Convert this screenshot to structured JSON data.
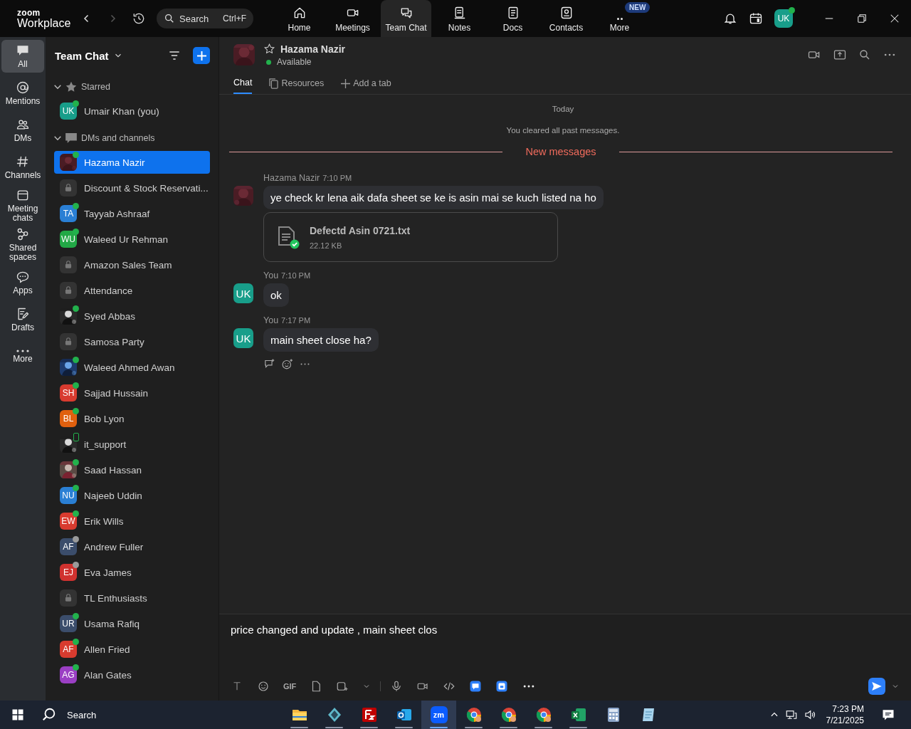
{
  "app": {
    "logo_top": "zoom",
    "logo_bottom": "Workplace"
  },
  "search": {
    "placeholder": "Search",
    "shortcut": "Ctrl+F"
  },
  "nav": [
    {
      "label": "Home",
      "selected": false
    },
    {
      "label": "Meetings",
      "selected": false
    },
    {
      "label": "Team Chat",
      "selected": true
    },
    {
      "label": "Notes",
      "selected": false
    },
    {
      "label": "Docs",
      "selected": false
    },
    {
      "label": "Contacts",
      "selected": false
    },
    {
      "label": "More",
      "selected": false,
      "badge": "NEW"
    }
  ],
  "user": {
    "initials": "UK",
    "online": true
  },
  "rail": [
    {
      "label": "All",
      "selected": true
    },
    {
      "label": "Mentions",
      "selected": false
    },
    {
      "label": "DMs",
      "selected": false
    },
    {
      "label": "Channels",
      "selected": false
    },
    {
      "label": "Meeting chats",
      "selected": false
    },
    {
      "label": "Shared spaces",
      "selected": false
    },
    {
      "label": "Apps",
      "selected": false
    },
    {
      "label": "Drafts",
      "selected": false
    },
    {
      "label": "More",
      "selected": false
    }
  ],
  "list": {
    "title": "Team Chat",
    "sections": [
      {
        "label": "Starred",
        "expanded": true,
        "items": [
          {
            "name": "Umair Khan (you)",
            "kind": "initials",
            "initials": "UK",
            "color": "#189e8a",
            "online": true,
            "selected": false
          }
        ]
      },
      {
        "label": "DMs and channels",
        "expanded": true,
        "items": [
          {
            "name": "Hazama Nazir",
            "kind": "picture",
            "online": true,
            "selected": true
          },
          {
            "name": "Discount & Stock Reservati...",
            "kind": "channel",
            "online": false,
            "selected": false
          },
          {
            "name": "Tayyab Ashraaf",
            "kind": "initials",
            "initials": "TA",
            "color": "#2a7fd4",
            "online": true,
            "selected": false
          },
          {
            "name": "Waleed Ur Rehman",
            "kind": "initials",
            "initials": "WU",
            "color": "#22a846",
            "online": true,
            "selected": false
          },
          {
            "name": "Amazon Sales Team",
            "kind": "channel",
            "online": false,
            "selected": false
          },
          {
            "name": "Attendance",
            "kind": "channel",
            "online": false,
            "selected": false
          },
          {
            "name": "Syed Abbas",
            "kind": "picture",
            "online": true,
            "selected": false
          },
          {
            "name": "Samosa Party",
            "kind": "channel",
            "online": false,
            "selected": false
          },
          {
            "name": "Waleed Ahmed Awan",
            "kind": "picture",
            "online": true,
            "selected": false
          },
          {
            "name": "Sajjad Hussain",
            "kind": "initials",
            "initials": "SH",
            "color": "#d83b2f",
            "online": true,
            "selected": false
          },
          {
            "name": "Bob Lyon",
            "kind": "initials",
            "initials": "BL",
            "color": "#e0600e",
            "online": true,
            "selected": false
          },
          {
            "name": "it_support",
            "kind": "picture",
            "online": false,
            "mobile": true,
            "selected": false
          },
          {
            "name": "Saad Hassan",
            "kind": "picture",
            "online": true,
            "selected": false
          },
          {
            "name": "Najeeb Uddin",
            "kind": "initials",
            "initials": "NU",
            "color": "#2a7fd4",
            "online": true,
            "selected": false
          },
          {
            "name": "Erik Wills",
            "kind": "initials",
            "initials": "EW",
            "color": "#d83b2f",
            "online": true,
            "selected": false
          },
          {
            "name": "Andrew Fuller",
            "kind": "initials",
            "initials": "AF",
            "color": "#3b4d6b",
            "online": false,
            "away": true,
            "selected": false
          },
          {
            "name": "Eva James",
            "kind": "initials",
            "initials": "EJ",
            "color": "#d0322f",
            "online": false,
            "away": true,
            "selected": false
          },
          {
            "name": "TL Enthusiasts",
            "kind": "channel",
            "online": false,
            "selected": false
          },
          {
            "name": "Usama Rafiq",
            "kind": "initials",
            "initials": "UR",
            "color": "#3b4d6b",
            "online": true,
            "selected": false
          },
          {
            "name": "Allen Fried",
            "kind": "initials",
            "initials": "AF",
            "color": "#d83b2f",
            "online": true,
            "selected": false
          },
          {
            "name": "Alan Gates",
            "kind": "initials",
            "initials": "AG",
            "color": "#9b3fc4",
            "online": true,
            "selected": false
          }
        ]
      }
    ]
  },
  "chat": {
    "name": "Hazama Nazir",
    "status": "Available",
    "starred": false,
    "tabs": [
      {
        "label": "Chat",
        "selected": true
      },
      {
        "label": "Resources",
        "selected": false
      },
      {
        "label": "Add a tab",
        "selected": false
      }
    ],
    "day": "Today",
    "notice": "You cleared all past messages.",
    "divider": "New messages",
    "messages": [
      {
        "sender": "Hazama Nazir",
        "time": "7:10 PM",
        "text": "ye check kr lena aik dafa sheet se ke is asin mai se kuch listed na ho",
        "attachment": {
          "name": "Defectd Asin 0721.txt",
          "size": "22.12 KB"
        },
        "hovered": false
      },
      {
        "sender": "You",
        "time": "7:10 PM",
        "avatar": {
          "kind": "initials",
          "initials": "UK",
          "color": "#189e8a"
        },
        "text": "ok",
        "hovered": false
      },
      {
        "sender": "You",
        "time": "7:17 PM",
        "avatar": {
          "kind": "initials",
          "initials": "UK",
          "color": "#189e8a"
        },
        "text": "main sheet close ha?",
        "hovered": true
      }
    ]
  },
  "composer": {
    "value": "price changed and update , main sheet clos",
    "gif": "GIF"
  },
  "taskbar": {
    "search": "Search",
    "time": "7:23 PM",
    "date": "7/21/2025",
    "apps": [
      {
        "kind": "folder",
        "running": true,
        "selected": false
      },
      {
        "kind": "gem",
        "running": true,
        "selected": false
      },
      {
        "kind": "filezilla",
        "running": true,
        "selected": false
      },
      {
        "kind": "outlook",
        "running": true,
        "selected": false
      },
      {
        "kind": "zoom",
        "glyph": "zm",
        "running": true,
        "selected": true
      },
      {
        "kind": "chrome",
        "running": true,
        "selected": false
      },
      {
        "kind": "chrome",
        "running": true,
        "selected": false
      },
      {
        "kind": "chrome",
        "running": true,
        "selected": false
      },
      {
        "kind": "excel",
        "running": true,
        "selected": false
      },
      {
        "kind": "calculator",
        "running": false,
        "selected": false
      },
      {
        "kind": "notepad",
        "running": false,
        "selected": false
      }
    ]
  }
}
